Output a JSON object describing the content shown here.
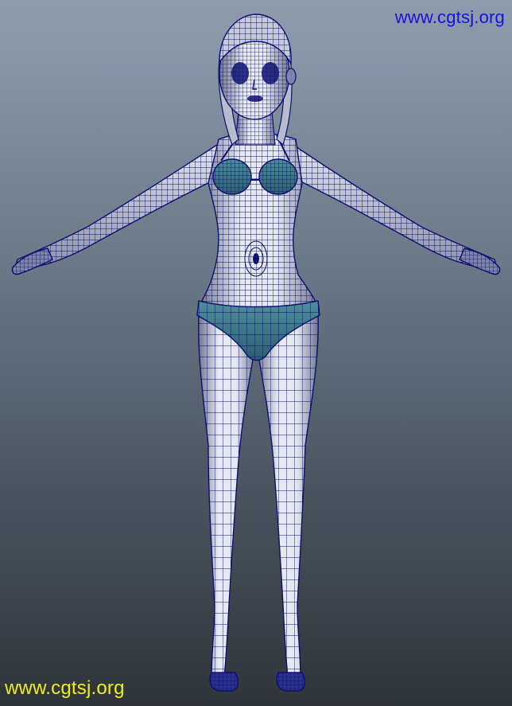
{
  "viewport": {
    "background_top": "#8e9cad",
    "background_bottom": "#2f3439",
    "mesh_color": "#0c1070",
    "skin_color": "#d9dde6",
    "garment_color": "#3b7a86"
  },
  "watermarks": {
    "top_text": "www.cgtsj.org",
    "top_color": "#1a10e6",
    "bottom_text": "www.cgtsj.org",
    "bottom_color": "#f2ee12"
  },
  "model": {
    "subject": "wireframe-female-character",
    "pose": "T-pose"
  }
}
